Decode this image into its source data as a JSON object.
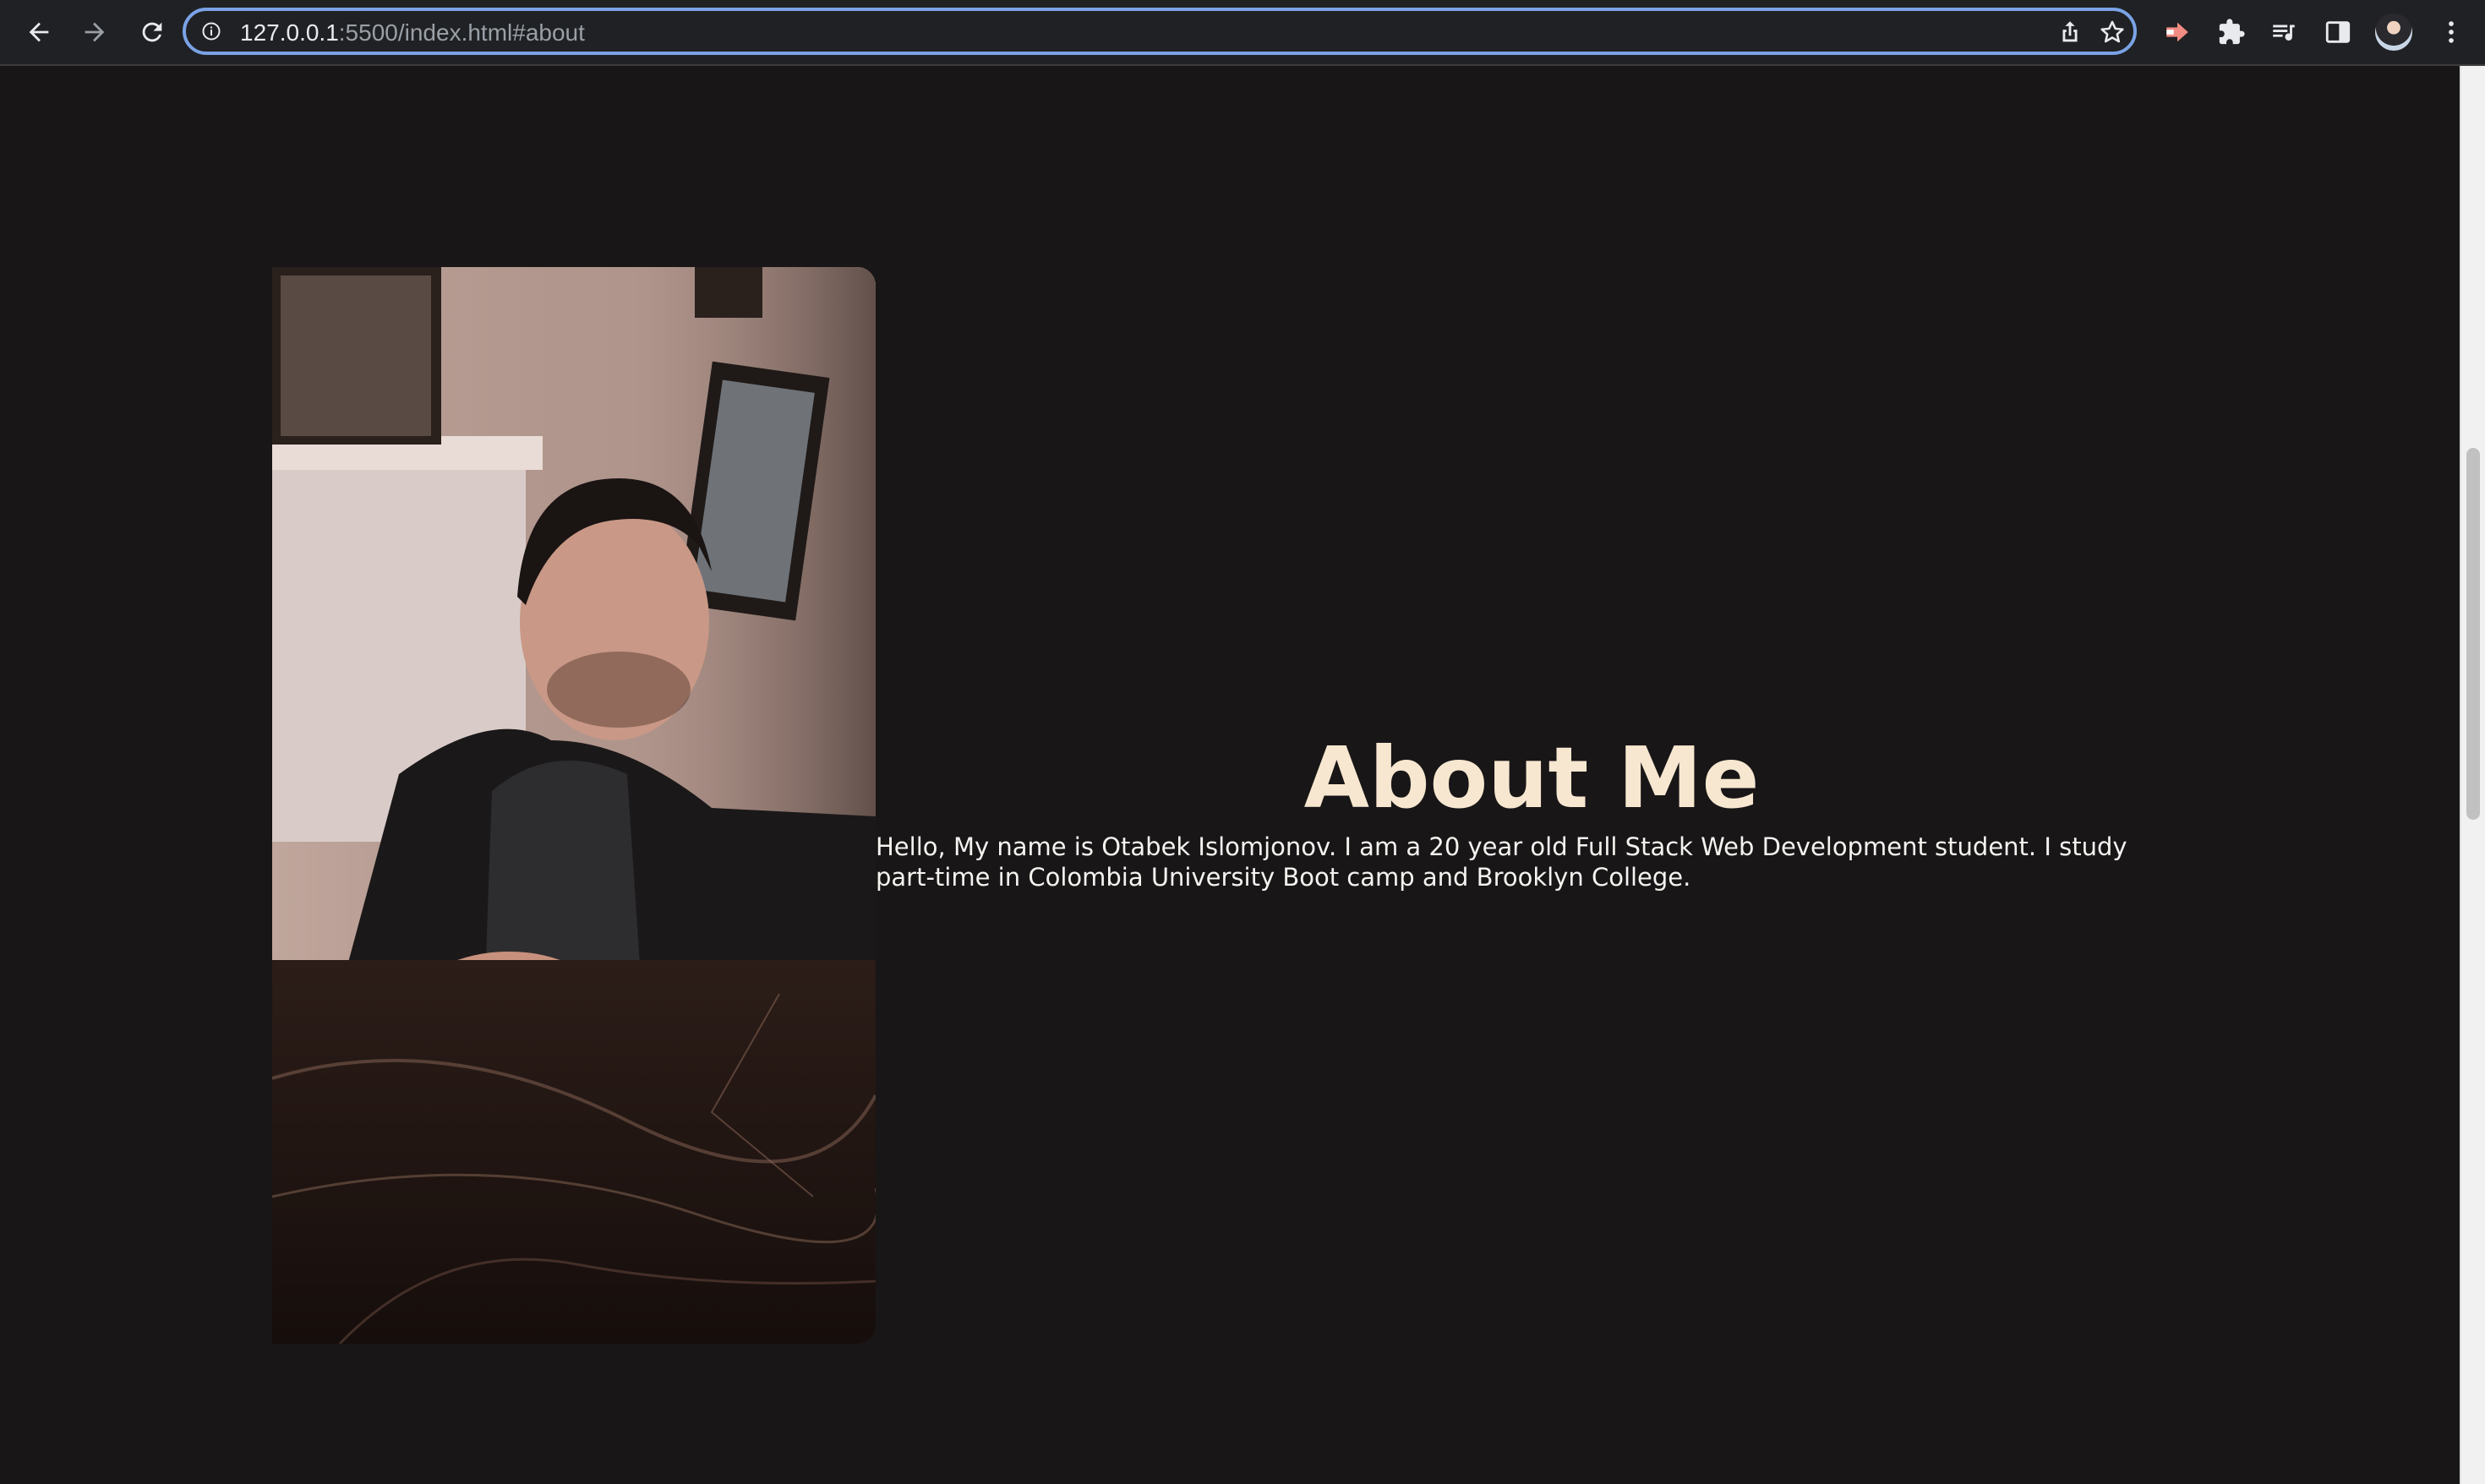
{
  "browser": {
    "url_host": "127.0.0.1",
    "url_rest": ":5500/index.html#about",
    "icons": [
      "back-arrow-icon",
      "forward-arrow-icon",
      "reload-icon",
      "info-icon",
      "share-icon",
      "star-icon",
      "extension-icon",
      "puzzle-icon",
      "reading-list-icon",
      "side-panel-icon",
      "profile-avatar",
      "kebab-menu-icon"
    ]
  },
  "about": {
    "title": "About Me",
    "text": "Hello, My name is Otabek Islomjonov. I am a 20 year old Full Stack Web Development student. I study part-time in Colombia University Boot camp and Brooklyn College."
  },
  "colors": {
    "page_background": "#181617",
    "title": "#f8e7d0",
    "body_text": "#f5f3ef",
    "omnibox_focus": "#7aa3e6"
  }
}
